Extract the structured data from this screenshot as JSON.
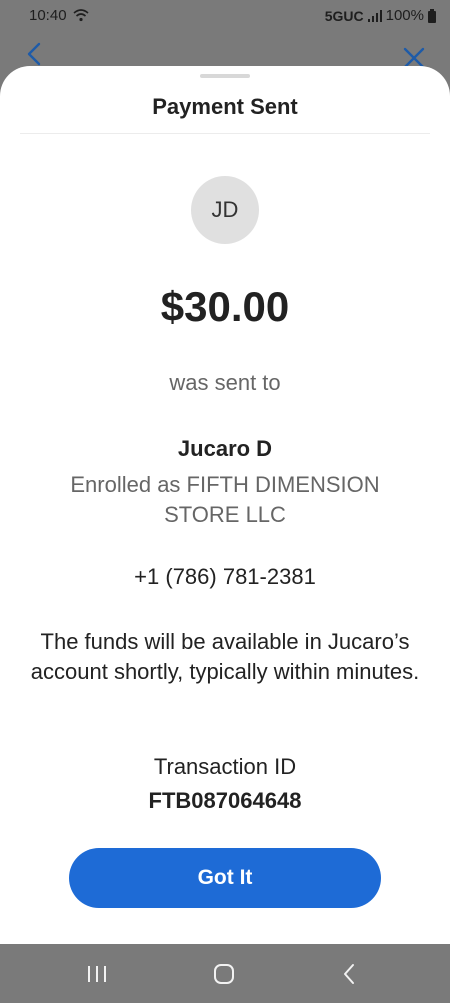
{
  "status_bar": {
    "time": "10:40",
    "network": "5GUC",
    "battery": "100%"
  },
  "header": {
    "back_icon": "chevron-left-icon",
    "close_icon": "close-icon",
    "accent_color": "#1e6bd6"
  },
  "sheet": {
    "title": "Payment Sent",
    "avatar_initials": "JD",
    "amount": "$30.00",
    "sent_to_label": "was sent to",
    "recipient_name": "Jucaro D",
    "enrolled_text": "Enrolled as FIFTH DIMENSION STORE LLC",
    "phone": "+1 (786) 781-2381",
    "funds_note": "The funds will be available in Jucaro’s account shortly, typically within minutes.",
    "transaction_label": "Transaction ID",
    "transaction_id": "FTB087064648",
    "button_label": "Got It",
    "button_color": "#1e6bd6"
  },
  "nav_bar": {
    "recent_icon": "recent-apps-icon",
    "home_icon": "home-icon",
    "back_icon": "back-icon"
  }
}
